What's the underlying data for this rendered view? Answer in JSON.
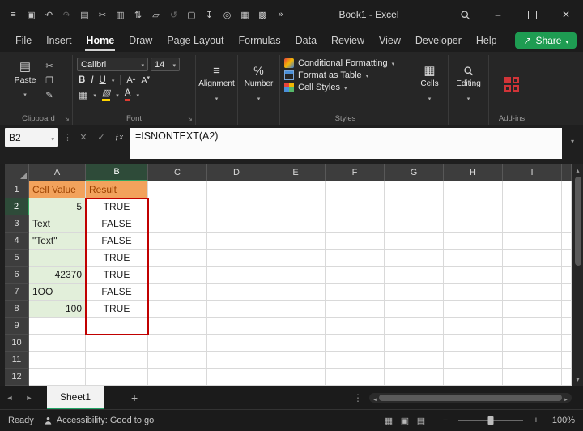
{
  "titlebar": {
    "title": "Book1 - Excel",
    "minimize": "–",
    "close": "✕",
    "icons": [
      {
        "name": "customize-toolbar-icon",
        "glyph": "≡"
      },
      {
        "name": "save-icon",
        "glyph": "▣"
      },
      {
        "name": "undo-icon",
        "glyph": "↶"
      },
      {
        "name": "redo-icon",
        "glyph": "↷",
        "dim": true
      },
      {
        "name": "clipboard-icon",
        "glyph": "▤"
      },
      {
        "name": "cut-icon",
        "glyph": "✂"
      },
      {
        "name": "chart-icon",
        "glyph": "▥"
      },
      {
        "name": "sort-icon",
        "glyph": "⇅"
      },
      {
        "name": "shape-icon",
        "glyph": "▱"
      },
      {
        "name": "repeat-icon",
        "glyph": "↺",
        "dim": true
      },
      {
        "name": "new-document-icon",
        "glyph": "▢"
      },
      {
        "name": "print-icon",
        "glyph": "↧"
      },
      {
        "name": "camera-icon",
        "glyph": "◎"
      },
      {
        "name": "borders-table-icon",
        "glyph": "▦"
      },
      {
        "name": "table-style-icon",
        "glyph": "▩"
      },
      {
        "name": "more-commands-icon",
        "glyph": "»"
      }
    ]
  },
  "menu": {
    "items": [
      "File",
      "Insert",
      "Home",
      "Draw",
      "Page Layout",
      "Formulas",
      "Data",
      "Review",
      "View",
      "Developer",
      "Help"
    ],
    "active": "Home",
    "share": {
      "label": "Share",
      "icon": "↗"
    }
  },
  "ribbon": {
    "clipboard": {
      "paste": "Paste",
      "label": "Clipboard",
      "cut_icon": "✂",
      "copy_icon": "❐",
      "painter_icon": "✎"
    },
    "font": {
      "name": "Calibri",
      "size": "14",
      "bold": "B",
      "italic": "I",
      "underline": "U",
      "grow": "A",
      "shrink": "A",
      "color_letter": "A",
      "label": "Font"
    },
    "alignment": {
      "label": "Alignment"
    },
    "number": {
      "label": "Number"
    },
    "styles": {
      "items": [
        "Conditional Formatting",
        "Format as Table",
        "Cell Styles"
      ],
      "label": "Styles"
    },
    "cells": {
      "label": "Cells"
    },
    "editing": {
      "label": "Editing"
    },
    "addins": {
      "label": "Add-ins"
    }
  },
  "formula_bar": {
    "name_box": "B2",
    "dots": "⋮",
    "cancel": "✕",
    "enter": "✓",
    "fx": "ƒx",
    "formula": "=ISNONTEXT(A2)"
  },
  "sheet": {
    "col_headers": [
      "A",
      "B",
      "C",
      "D",
      "E",
      "F",
      "G",
      "H",
      "I"
    ],
    "selected_col": "B",
    "selected_row": "2",
    "rows": [
      {
        "n": "1",
        "a": "Cell Value",
        "b": "Result"
      },
      {
        "n": "2",
        "a": "5",
        "b": "TRUE",
        "a_align": "right"
      },
      {
        "n": "3",
        "a": "Text",
        "b": "FALSE",
        "a_align": "left"
      },
      {
        "n": "4",
        "a": "\"Text\"",
        "b": "FALSE",
        "a_align": "left"
      },
      {
        "n": "5",
        "a": "",
        "b": "TRUE"
      },
      {
        "n": "6",
        "a": "42370",
        "b": "TRUE",
        "a_align": "right"
      },
      {
        "n": "7",
        "a": "1OO",
        "b": "FALSE",
        "a_align": "left"
      },
      {
        "n": "8",
        "a": "100",
        "b": "TRUE",
        "a_align": "right"
      },
      {
        "n": "9",
        "a": "",
        "b": ""
      },
      {
        "n": "10",
        "a": "",
        "b": ""
      },
      {
        "n": "11",
        "a": "",
        "b": ""
      },
      {
        "n": "12",
        "a": "",
        "b": ""
      }
    ]
  },
  "tabs": {
    "sheet_name": "Sheet1",
    "add": "+",
    "prev": "◄",
    "next": "►",
    "menu": "⋮"
  },
  "status": {
    "mode": "Ready",
    "accessibility": "Accessibility: Good to go",
    "zoom": "100%",
    "minus": "−",
    "plus": "+",
    "view_icons": [
      {
        "name": "normal-view-icon",
        "glyph": "▦"
      },
      {
        "name": "page-layout-view-icon",
        "glyph": "▣"
      },
      {
        "name": "page-break-view-icon",
        "glyph": "▤"
      }
    ]
  },
  "colors": {
    "accent_green": "#21A366",
    "share_green": "#1E9C52",
    "header_orange": "#F2A25C",
    "header_orange_text": "#9C4100",
    "input_green": "#E2EFDA",
    "range_red": "#C00000"
  }
}
